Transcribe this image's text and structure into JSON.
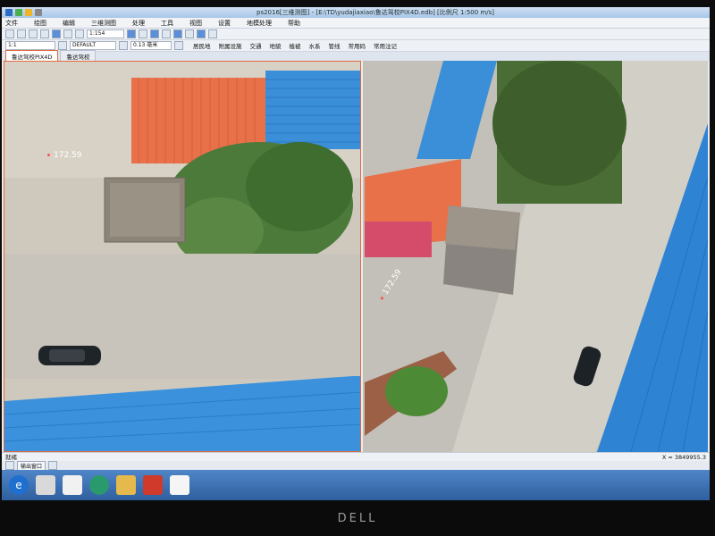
{
  "window": {
    "title": "ps2016[三维测图] - [E:\\TD\\yudajiaxiao\\鲁达驾校PIX4D.edb] [比例尺 1:500 m/s]"
  },
  "menu": {
    "items": [
      "文件",
      "绘图",
      "编辑",
      "三维测图",
      "处理",
      "工具",
      "视图",
      "设置",
      "地模处理",
      "帮助"
    ]
  },
  "toolbar": {
    "scale_value": "1:154",
    "layer_scale": "1:1",
    "layer_name": "DEFAULT",
    "line_width": "0.13 毫米"
  },
  "feature_menu": {
    "items": [
      "居民地",
      "附属设施",
      "交通",
      "地貌",
      "植被",
      "水系",
      "管线",
      "常用码",
      "常用注记"
    ]
  },
  "tabs": {
    "left": "鲁达驾校PIX4D",
    "right": "鲁达驾校"
  },
  "views": {
    "left_elevation": "172.59",
    "right_elevation": "172.59"
  },
  "status": {
    "ready": "就绪",
    "coord": "X = 3849955.3",
    "sub_label": "输出窗口"
  },
  "colors": {
    "accent": "#e06a3c",
    "roof_orange": "#e8714a",
    "roof_blue": "#3a8fd8",
    "taskbar": "#2f5f9e"
  },
  "icons": {
    "ie": "ie-icon",
    "media": "media-icon",
    "file": "file-icon",
    "search": "search-icon",
    "folder": "folder-icon",
    "app": "app-icon"
  }
}
